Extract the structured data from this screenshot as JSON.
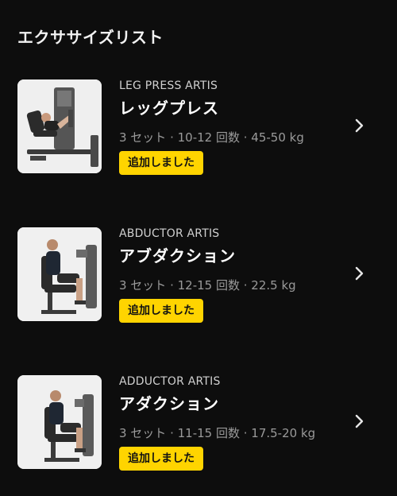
{
  "header": {
    "title": "エクササイズリスト"
  },
  "exercises": [
    {
      "brand": "LEG PRESS ARTIS",
      "name": "レッグプレス",
      "meta": "3 セット · 10-12 回数 · 45-50 kg",
      "badge": "追加しました",
      "image_icon": "leg-press-machine-icon",
      "chevron_icon": "chevron-right-icon"
    },
    {
      "brand": "ABDUCTOR ARTIS",
      "name": "アブダクション",
      "meta": "3 セット · 12-15 回数 · 22.5 kg",
      "badge": "追加しました",
      "image_icon": "abductor-machine-icon",
      "chevron_icon": "chevron-right-icon"
    },
    {
      "brand": "ADDUCTOR ARTIS",
      "name": "アダクション",
      "meta": "3 セット · 11-15 回数 · 17.5-20 kg",
      "badge": "追加しました",
      "image_icon": "adductor-machine-icon",
      "chevron_icon": "chevron-right-icon"
    }
  ],
  "colors": {
    "background": "#0d0d0d",
    "badge": "#ffd400",
    "meta_text": "#9a9a9a"
  }
}
